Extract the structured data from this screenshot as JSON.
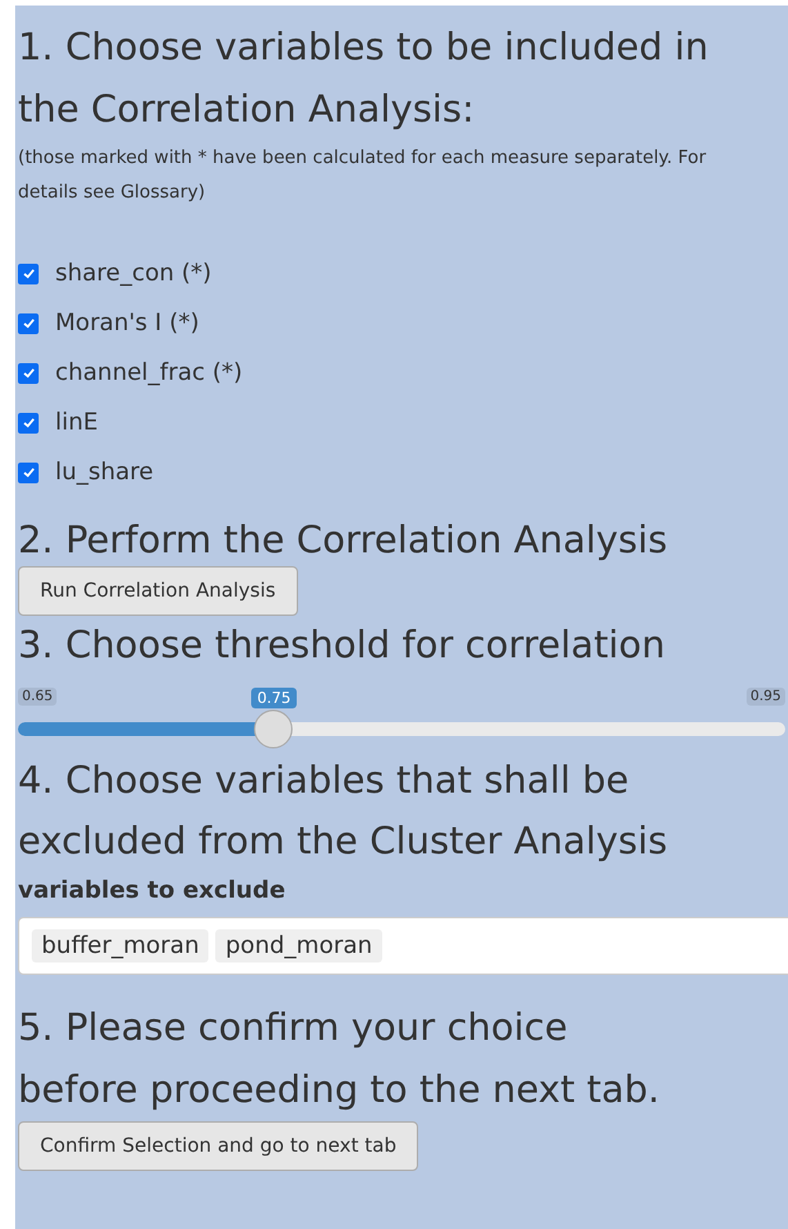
{
  "step1": {
    "heading": "1. Choose variables to be included in the Correlation Analysis:",
    "note": "(those marked with * have been calculated for each measure separately. For details see Glossary)",
    "variables": [
      {
        "label": "share_con (*)",
        "checked": true
      },
      {
        "label": "Moran's I (*)",
        "checked": true
      },
      {
        "label": "channel_frac (*)",
        "checked": true
      },
      {
        "label": "linE",
        "checked": true
      },
      {
        "label": "lu_share",
        "checked": true
      }
    ]
  },
  "step2": {
    "heading": "2. Perform the Correlation Analysis",
    "button": "Run Correlation Analysis"
  },
  "step3": {
    "heading": "3. Choose threshold for correlation",
    "slider": {
      "min": "0.65",
      "value": "0.75",
      "max": "0.95",
      "level": 0.3333
    }
  },
  "step4": {
    "heading": "4. Choose variables that shall be excluded from the Cluster Analysis",
    "label": "variables to exclude",
    "tags": [
      "buffer_moran",
      "pond_moran"
    ]
  },
  "step5": {
    "heading": "5. Please confirm your choice before proceeding to the next tab.",
    "button": "Confirm Selection and go to next tab"
  }
}
